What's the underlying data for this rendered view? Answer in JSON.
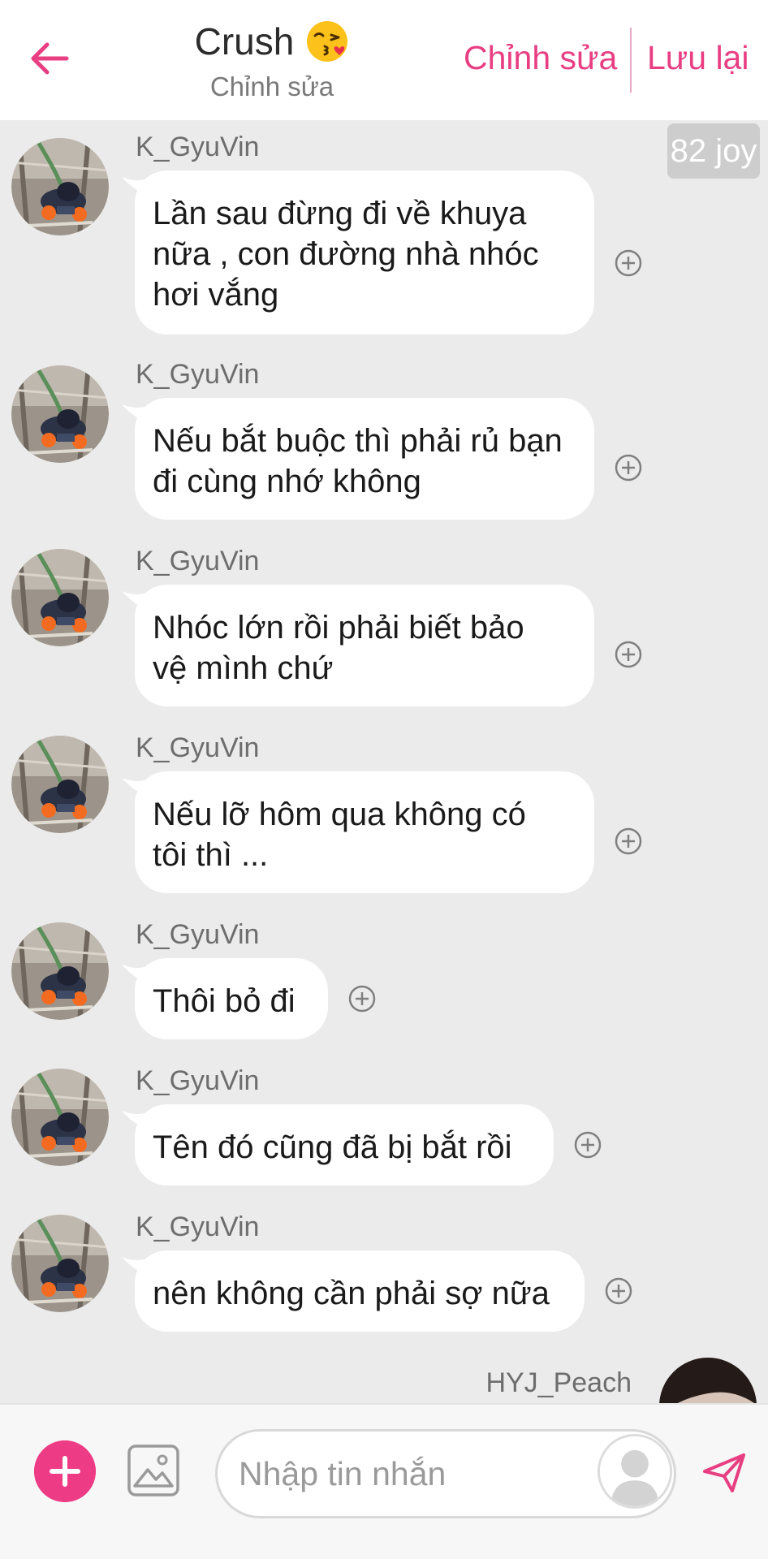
{
  "header": {
    "title": "Crush",
    "subtitle": "Chỉnh sửa",
    "edit_label": "Chỉnh sửa",
    "save_label": "Lưu lại",
    "back_icon": "arrow-left-icon",
    "title_emoji": "kissing-face-emoji-icon"
  },
  "chat": {
    "joy_badge": "82 joy",
    "messages": [
      {
        "sender": "K_GyuVin",
        "text": "Lần sau đừng đi về khuya\nnữa , con đường nhà nhóc\nhơi vắng"
      },
      {
        "sender": "K_GyuVin",
        "text": "Nếu bắt buộc thì phải rủ bạn\nđi cùng nhớ không"
      },
      {
        "sender": "K_GyuVin",
        "text": "Nhóc lớn rồi phải biết bảo\nvệ mình chứ"
      },
      {
        "sender": "K_GyuVin",
        "text": "Nếu lỡ hôm qua không có\ntôi thì ..."
      },
      {
        "sender": "K_GyuVin",
        "text": "Thôi bỏ đi"
      },
      {
        "sender": "K_GyuVin",
        "text": "Tên đó cũng đã bị bắt rồi"
      },
      {
        "sender": "K_GyuVin",
        "text": "nên không cần phải sợ nữa"
      }
    ],
    "me_sender": "HYJ_Peach"
  },
  "input_bar": {
    "placeholder": "Nhập tin nhắn",
    "add_icon": "plus-icon",
    "image_icon": "image-icon",
    "send_icon": "send-icon"
  },
  "colors": {
    "accent": "#e83e82",
    "background": "#ebebeb",
    "bubble": "#ffffff"
  }
}
